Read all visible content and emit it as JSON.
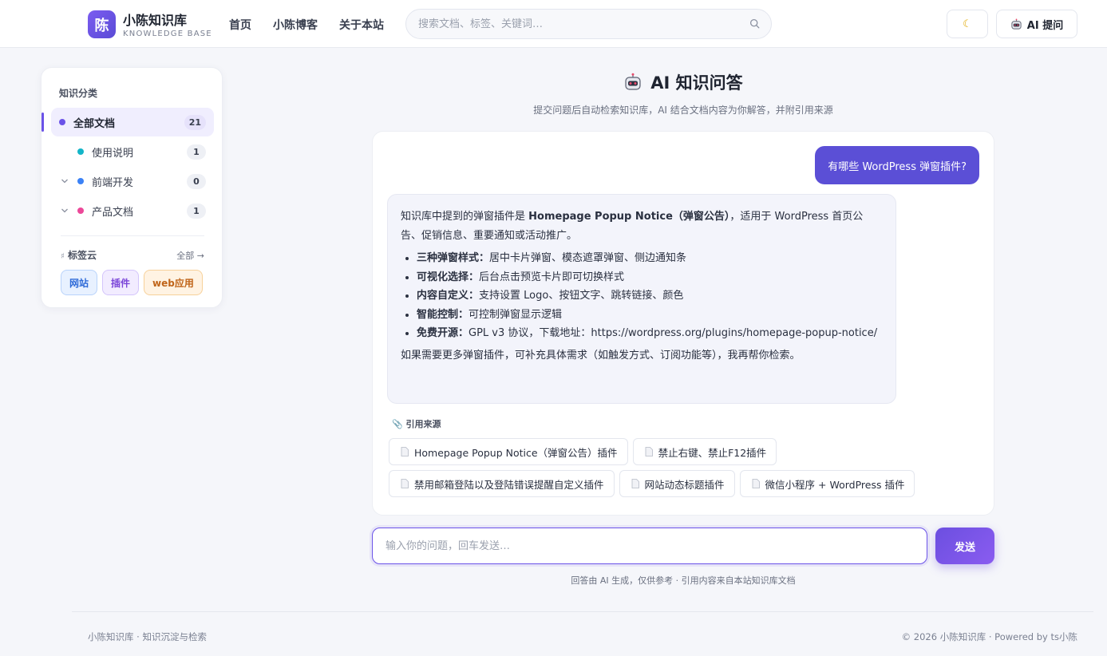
{
  "header": {
    "logo_char": "陈",
    "site_title": "小陈知识库",
    "site_subtitle": "KNOWLEDGE BASE",
    "nav": [
      "首页",
      "小陈博客",
      "关于本站"
    ],
    "search_placeholder": "搜索文档、标签、关键词…",
    "ai_button": "AI 提问",
    "theme_icon": "moon-icon"
  },
  "sidebar": {
    "title": "知识分类",
    "categories": [
      {
        "label": "全部文档",
        "count": "21",
        "color": "#6a52e8",
        "active": true
      },
      {
        "label": "使用说明",
        "count": "1",
        "color": "#13b5c8"
      },
      {
        "label": "前端开发",
        "count": "0",
        "color": "#3b82f6",
        "expandable": true
      },
      {
        "label": "产品文档",
        "count": "1",
        "color": "#ec4899",
        "expandable": true
      }
    ],
    "tag_cloud_title": "标签云",
    "tag_cloud_all": "全部 →",
    "tags": [
      "网站",
      "插件",
      "web应用"
    ]
  },
  "main": {
    "title": "AI 知识问答",
    "subtitle": "提交问题后自动检索知识库，AI 结合文档内容为你解答，并附引用来源",
    "user_question": "有哪些 WordPress 弹窗插件?",
    "answer": {
      "intro_prefix": "知识库中提到的弹窗插件是 ",
      "intro_bold": "Homepage Popup Notice（弹窗公告）",
      "intro_suffix": "，适用于 WordPress 首页公告、促销信息、重要通知或活动推广。",
      "bullets": [
        {
          "bold": "三种弹窗样式：",
          "text": "居中卡片弹窗、模态遮罩弹窗、侧边通知条"
        },
        {
          "bold": "可视化选择：",
          "text": "后台点击预览卡片即可切换样式"
        },
        {
          "bold": "内容自定义：",
          "text": "支持设置 Logo、按钮文字、跳转链接、颜色"
        },
        {
          "bold": "智能控制：",
          "text": "可控制弹窗显示逻辑"
        },
        {
          "bold": "免费开源：",
          "text": "GPL v3 协议，下载地址：https://wordpress.org/plugins/homepage-popup-notice/"
        }
      ],
      "closing": "如果需要更多弹窗插件，可补充具体需求（如触发方式、订阅功能等），我再帮你检索。"
    },
    "sources_title": "引用来源",
    "sources_row1": [
      "Homepage Popup Notice（弹窗公告）插件",
      "禁止右键、禁止F12插件"
    ],
    "sources_row2": [
      "禁用邮箱登陆以及登陆错误提醒自定义插件",
      "网站动态标题插件",
      "微信小程序 + WordPress 插件"
    ],
    "input_placeholder": "输入你的问题，回车发送…",
    "send_label": "发送",
    "disclaimer": "回答由 AI 生成，仅供参考 · 引用内容来自本站知识库文档"
  },
  "footer": {
    "left": "小陈知识库 · 知识沉淀与检索",
    "right": "© 2026 小陈知识库 · Powered by ts小陈"
  },
  "colors": {
    "accent": "#5b4fd6",
    "accent_light": "#f0eefe"
  }
}
